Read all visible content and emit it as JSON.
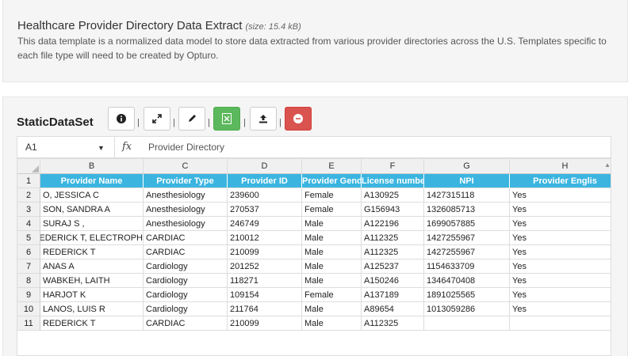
{
  "header": {
    "title": "Healthcare Provider Directory Data Extract",
    "size": "(size: 15.4 kB)",
    "description": "This data template is a normalized data model to store data extracted from various provider directories across the U.S. Templates specific to each file type will need to be created by Opturo."
  },
  "dataset": {
    "title": "StaticDataSet",
    "toolbar": {
      "info": "info-icon",
      "expand": "expand-icon",
      "edit": "pencil-icon",
      "excel": "excel-icon",
      "upload": "upload-icon",
      "remove": "minus-circle-icon",
      "separator": "|"
    },
    "formula_bar": {
      "cell_ref": "A1",
      "fx": "fx",
      "value": "Provider Directory"
    },
    "columns": [
      "B",
      "C",
      "D",
      "E",
      "F",
      "G",
      "H"
    ],
    "header_row": [
      "Provider Name",
      "Provider Type",
      "Provider ID",
      "Provider Gende",
      "License numbe",
      "NPI",
      "Provider Englis"
    ],
    "rows": [
      {
        "num": "1"
      },
      {
        "num": "2",
        "cells": [
          "O, JESSICA C",
          "Anesthesiology",
          "239600",
          "Female",
          "A130925",
          "1427315118",
          "Yes"
        ]
      },
      {
        "num": "3",
        "cells": [
          "SON, SANDRA A",
          "Anesthesiology",
          "270537",
          "Female",
          "G156943",
          "1326085713",
          "Yes"
        ]
      },
      {
        "num": "4",
        "cells": [
          ", SURAJ S",
          "Anesthesiology",
          "246749",
          "Male",
          "A122196",
          "1699057885",
          "Yes"
        ]
      },
      {
        "num": "5",
        "cells": [
          "REDERICK T, ELECTROPH",
          "CARDIAC",
          "210012",
          "Male",
          "A112325",
          "1427255967",
          "Yes"
        ]
      },
      {
        "num": "6",
        "cells": [
          "REDERICK T",
          "CARDIAC",
          "210099",
          "Male",
          "A112325",
          "1427255967",
          "Yes"
        ]
      },
      {
        "num": "7",
        "cells": [
          "ANAS A",
          "Cardiology",
          "201252",
          "Male",
          "A125237",
          "1154633709",
          "Yes"
        ]
      },
      {
        "num": "8",
        "cells": [
          "WABKEH, LAITH",
          "Cardiology",
          "118271",
          "Male",
          "A150246",
          "1346470408",
          "Yes"
        ]
      },
      {
        "num": "9",
        "cells": [
          "HARJOT K",
          "Cardiology",
          "109154",
          "Female",
          "A137189",
          "1891025565",
          "Yes"
        ]
      },
      {
        "num": "10",
        "cells": [
          "LANOS, LUIS R",
          "Cardiology",
          "211764",
          "Male",
          "A89654",
          "1013059286",
          "Yes"
        ]
      },
      {
        "num": "11",
        "cells": [
          "REDERICK T",
          "CARDIAC",
          "210099",
          "Male",
          "A112325",
          "",
          ""
        ]
      }
    ]
  }
}
